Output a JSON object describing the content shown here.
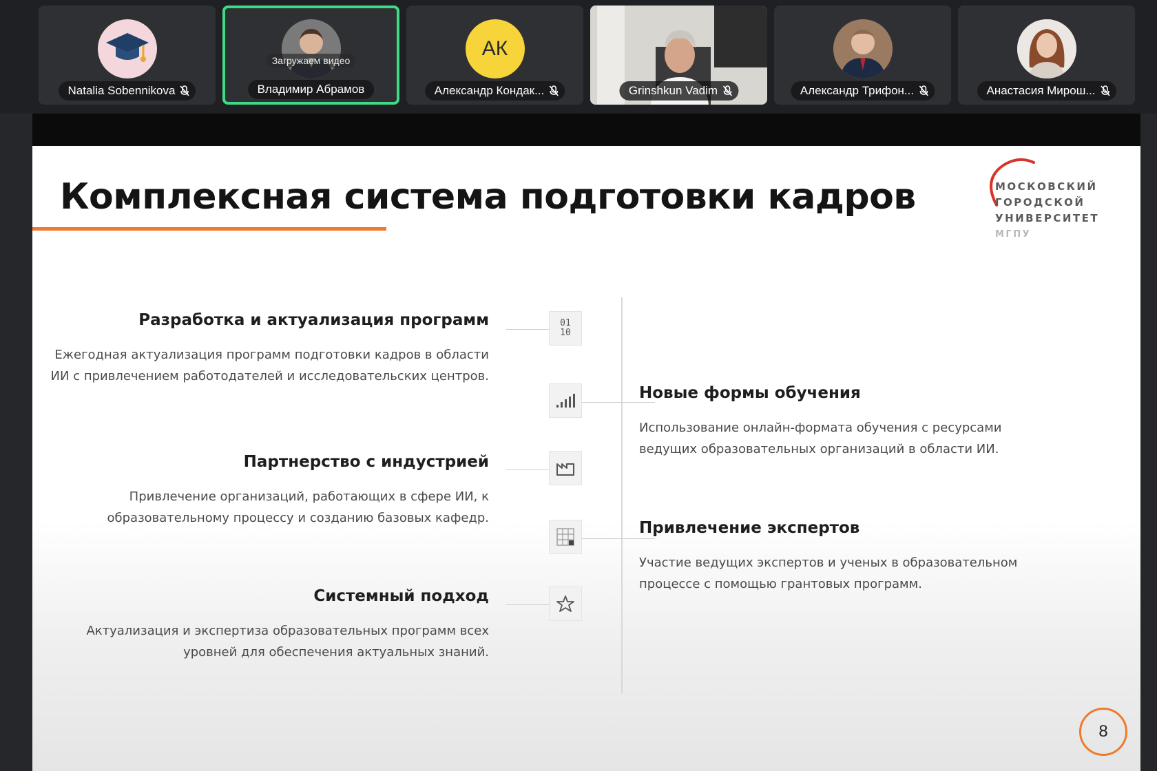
{
  "participants": [
    {
      "name": "Natalia Sobennikova",
      "avatar_icon": "graduation-cap-icon",
      "muted": true
    },
    {
      "name": "Владимир Абрамов",
      "status": "Загружаем видео",
      "active_speaker": true,
      "muted": false
    },
    {
      "name": "Александр Кондак...",
      "initials": "АК",
      "initials_color": "#F7D43A",
      "muted": true
    },
    {
      "name": "Grinshkun Vadim",
      "video": true,
      "muted": true
    },
    {
      "name": "Александр Трифон...",
      "muted": true
    },
    {
      "name": "Анастасия Мирош...",
      "muted": true
    }
  ],
  "slide": {
    "title": "Комплексная система подготовки кадров",
    "logo": {
      "line1": "МОСКОВСКИЙ",
      "line2": "ГОРОДСКОЙ",
      "line3": "УНИВЕРСИТЕТ",
      "line4": "МГПУ"
    },
    "left_blocks": [
      {
        "heading": "Разработка и актуализация программ",
        "text": "Ежегодная актуализация программ подготовки кадров в области ИИ с привлечением работодателей и исследовательских центров."
      },
      {
        "heading": "Партнерство с индустрией",
        "text": "Привлечение организаций, работающих в сфере ИИ, к образовательному процессу и созданию базовых кафедр."
      },
      {
        "heading": "Системный подход",
        "text": "Актуализация и экспертиза образовательных программ всех уровней для обеспечения актуальных знаний."
      }
    ],
    "right_blocks": [
      {
        "heading": "Новые формы обучения",
        "text": "Использование онлайн-формата обучения с ресурсами ведущих образовательных организаций в области ИИ."
      },
      {
        "heading": "Привлечение экспертов",
        "text": "Участие ведущих экспертов и ученых в образовательном процессе с помощью грантовых программ."
      }
    ],
    "icons": {
      "binary_top": "01",
      "binary_bottom": "10"
    },
    "page_number": "8"
  },
  "colors": {
    "accent_orange": "#EF7A2D",
    "active_speaker_border": "#3DDC84",
    "logo_red": "#D9342B"
  }
}
